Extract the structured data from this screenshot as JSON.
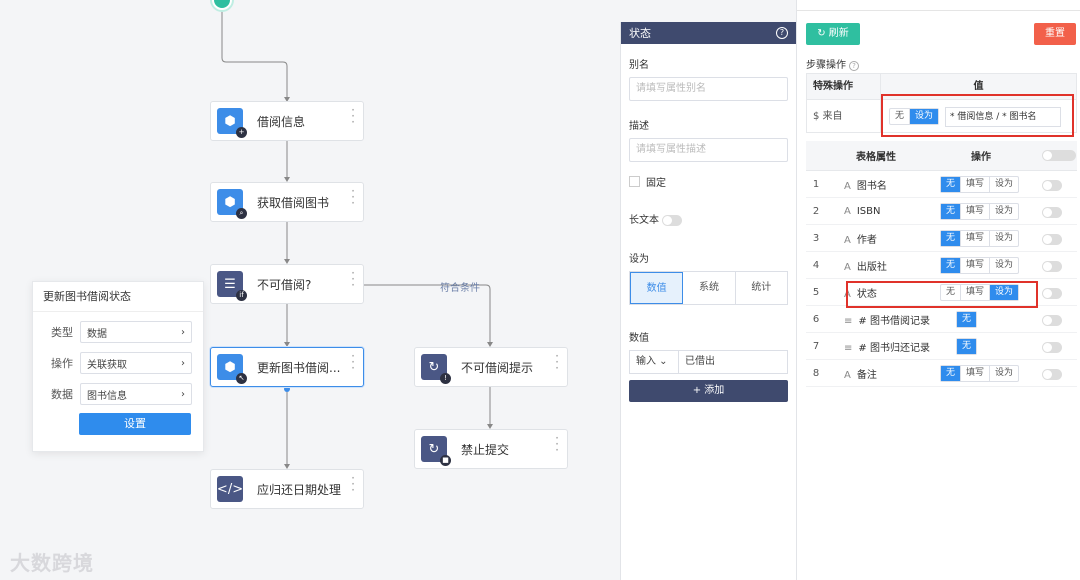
{
  "flow": {
    "nodes": [
      {
        "id": "borrow-info",
        "label": "借阅信息",
        "badge": "+",
        "kind": "blue",
        "icon": "cube-icon"
      },
      {
        "id": "get-book",
        "label": "获取借阅图书",
        "badge": "⌕",
        "kind": "blue",
        "icon": "cube-icon"
      },
      {
        "id": "not-borrowable",
        "label": "不可借阅?",
        "badge": "if",
        "kind": "navy",
        "icon": "condition-icon"
      },
      {
        "id": "update-status",
        "label": "更新图书借阅...",
        "badge": "↖",
        "kind": "blue",
        "icon": "cube-icon",
        "selected": true
      },
      {
        "id": "due-date",
        "label": "应归还日期处理",
        "badge": "",
        "kind": "navy",
        "icon": "code-icon"
      },
      {
        "id": "not-borrow-tip",
        "label": "不可借阅提示",
        "badge": "!",
        "kind": "navy",
        "icon": "loop-icon"
      },
      {
        "id": "forbid-submit",
        "label": "禁止提交",
        "badge": "■",
        "kind": "navy",
        "icon": "loop-icon"
      }
    ],
    "condition_label": "符合条件",
    "watermark": "大数跨境"
  },
  "popup": {
    "title": "更新图书借阅状态",
    "rows": [
      {
        "key": "类型",
        "value": "数据"
      },
      {
        "key": "操作",
        "value": "关联获取"
      },
      {
        "key": "数据",
        "value": "图书信息"
      }
    ],
    "button": "设置"
  },
  "panel": {
    "title": "状态",
    "alias_label": "别名",
    "alias_placeholder": "请填写属性别名",
    "desc_label": "描述",
    "desc_placeholder": "请填写属性描述",
    "fixed_label": "固定",
    "long_text_label": "长文本",
    "set_as_label": "设为",
    "set_as_options": [
      "数值",
      "系统",
      "统计"
    ],
    "value_label": "数值",
    "input_mode": "输入",
    "value": "已借出",
    "add_button": "+ 添加"
  },
  "right": {
    "refresh": "刷新",
    "reset": "重置",
    "steps_label": "步骤操作",
    "special_op_header": "特殊操作",
    "value_header": "值",
    "from_label": "$ 来自",
    "none": "无",
    "set_as": "设为",
    "from_value": "* 借阅信息 / * 图书名",
    "attr_header": "表格属性",
    "op_header": "操作",
    "fill": "填写",
    "rows": [
      {
        "n": "1",
        "name": "图书名",
        "icon": "A",
        "ops": [
          "无",
          "填写",
          "设为"
        ],
        "active": 0
      },
      {
        "n": "2",
        "name": "ISBN",
        "icon": "A",
        "ops": [
          "无",
          "填写",
          "设为"
        ],
        "active": 0
      },
      {
        "n": "3",
        "name": "作者",
        "icon": "A",
        "ops": [
          "无",
          "填写",
          "设为"
        ],
        "active": 0
      },
      {
        "n": "4",
        "name": "出版社",
        "icon": "A",
        "ops": [
          "无",
          "填写",
          "设为"
        ],
        "active": 0
      },
      {
        "n": "5",
        "name": "状态",
        "icon": "A",
        "ops": [
          "无",
          "填写",
          "设为"
        ],
        "active": 2
      },
      {
        "n": "6",
        "name": "# 图书借阅记录",
        "icon": "≡",
        "ops": [
          "无"
        ],
        "active": 0
      },
      {
        "n": "7",
        "name": "# 图书归还记录",
        "icon": "≡",
        "ops": [
          "无"
        ],
        "active": 0
      },
      {
        "n": "8",
        "name": "备注",
        "icon": "A",
        "ops": [
          "无",
          "填写",
          "设为"
        ],
        "active": 0
      }
    ]
  },
  "colors": {
    "primary": "#2f8ced",
    "teal": "#2fbfa0",
    "danger": "#f2604a",
    "navy": "#3f4a6e",
    "highlight": "#e0322a"
  }
}
